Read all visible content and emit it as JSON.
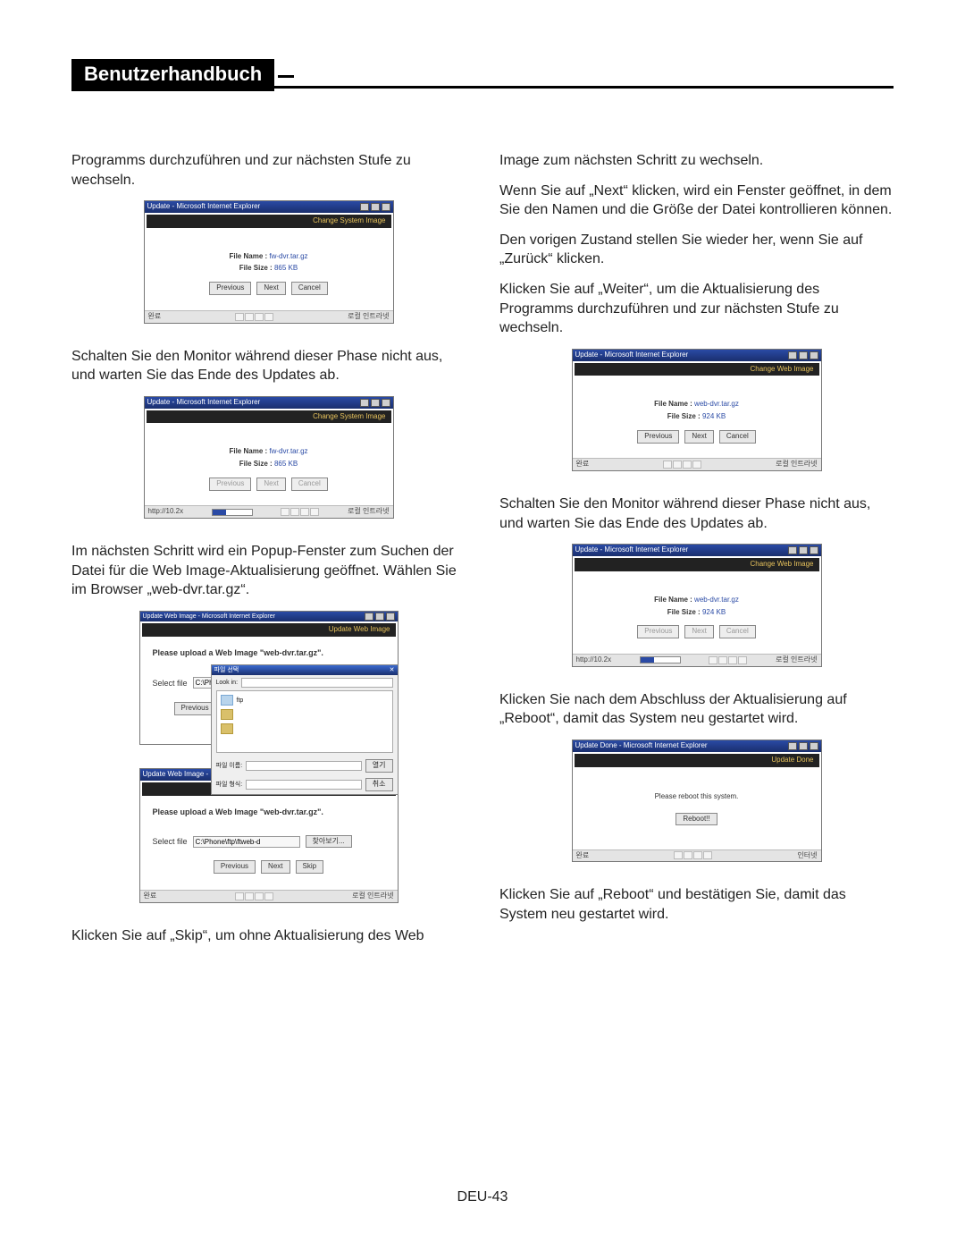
{
  "header": {
    "title": "Benutzerhandbuch"
  },
  "footer": {
    "page": "DEU-43"
  },
  "left": {
    "p1": "Programms durchzuführen und zur nächsten Stufe zu wechseln.",
    "p2": "Schalten Sie den Monitor während dieser Phase nicht aus, und warten Sie das Ende des Updates ab.",
    "p3": "Im nächsten Schritt wird ein Popup-Fenster zum Suchen der Datei für die Web Image-Aktualisierung geöffnet. Wählen Sie im Browser „web-dvr.tar.gz“.",
    "p4": "Klicken Sie auf „Skip“, um ohne Aktualisierung des Web"
  },
  "right": {
    "p1": "Image zum nächsten Schritt zu wechseln.",
    "p2": "Wenn Sie auf „Next“ klicken, wird ein Fenster geöffnet, in dem Sie den Namen und die Größe der Datei kontrollieren können.",
    "p3": "Den vorigen Zustand stellen Sie wieder her, wenn Sie auf „Zurück“ klicken.",
    "p4": "Klicken Sie auf „Weiter“, um die Aktualisierung des Programms durchzuführen und zur nächsten Stufe zu wechseln.",
    "p5": "Schalten Sie den Monitor während dieser Phase nicht aus, und warten Sie das Ende des Updates ab.",
    "p6": "Klicken Sie nach dem Abschluss der Aktualisierung auf „Reboot“, damit das System neu gestartet wird.",
    "p7": "Klicken Sie auf „Reboot“ und bestätigen Sie, damit das System neu gestartet wird."
  },
  "win": {
    "titleUpdate": "Update - Microsoft Internet Explorer",
    "titleUpdateWeb": "Update Web Image - Microsoft Internet Explorer",
    "titleUpdateDone": "Update Done - Microsoft Internet Explorer",
    "bannerSystem": "Change System Image",
    "bannerWeb": "Change Web Image",
    "bannerUpdateWeb": "Update Web Image",
    "bannerUpdateDone": "Update Done",
    "fileNameLabel": "File Name :",
    "fileSizeLabel": "File Size :",
    "fwFile": "fw-dvr.tar.gz",
    "fwSize": "865 KB",
    "webFile": "web-dvr.tar.gz",
    "webSize": "924 KB",
    "prev": "Previous",
    "next": "Next",
    "cancel": "Cancel",
    "skip": "Skip",
    "browse": "찾아보기...",
    "uploadPrompt": "Please upload a Web Image \"web-dvr.tar.gz\".",
    "selectFile": "Select file",
    "selectValue": "C:\\Phone\\ftp\\ftweb-d",
    "statusDone": "완료",
    "statusIntranet": "로컬 인트라넷",
    "statusUrl": "http://10.2x",
    "statusInternet": "인터넷",
    "rebootMsg": "Please reboot this system.",
    "rebootBtn": "Reboot!!",
    "fileDlgTitle": "파일 선택",
    "lookIn": "Look in:",
    "openBtn": "열기",
    "cancelBtn": "취소",
    "fnLbl": "파일 이름:",
    "ftLbl": "파일 형식:"
  }
}
